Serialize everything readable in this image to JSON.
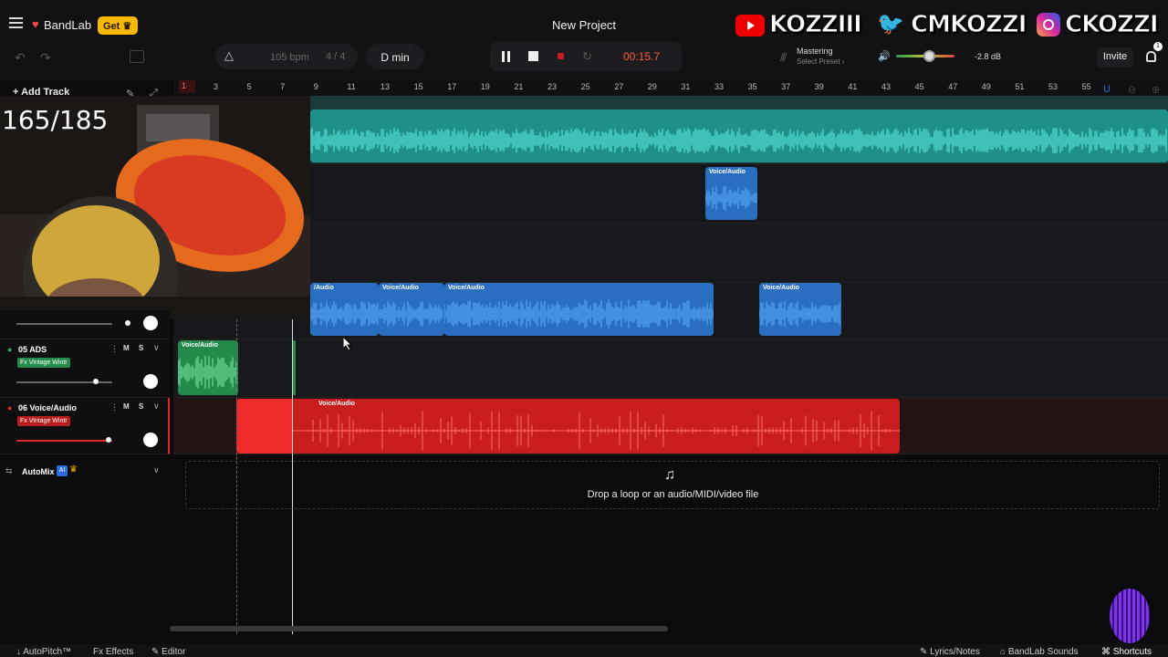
{
  "header": {
    "logo_text": "BandLab",
    "get_label": "Get",
    "project_title": "New Project",
    "socials": {
      "youtube": "KOZZIII",
      "twitter": "CMKOZZI",
      "instagram": "CKOZZI"
    }
  },
  "transport": {
    "bpm": "105 bpm",
    "time_signature": "4 / 4",
    "key": "D min",
    "time": "00:15.7",
    "mastering_label": "Mastering",
    "preset_label": "Select Preset",
    "volume_db": "-2.8 dB",
    "invite_label": "Invite",
    "notification_count": "1"
  },
  "toolbar": {
    "add_track_label": "Add Track"
  },
  "ruler": {
    "playhead_label": "1",
    "bars": [
      "3",
      "5",
      "7",
      "9",
      "11",
      "13",
      "15",
      "17",
      "19",
      "21",
      "23",
      "25",
      "27",
      "29",
      "31",
      "33",
      "35",
      "37",
      "39",
      "41",
      "43",
      "45",
      "47",
      "49",
      "51",
      "53",
      "55"
    ]
  },
  "overlay": {
    "counter": "165/185"
  },
  "tracks": [
    {
      "number": "05",
      "name": "ADS",
      "fx": "Fx Vintage Wintr",
      "mute": "M",
      "solo": "S",
      "color": "#2fae5c",
      "volume": 0.8
    },
    {
      "number": "06",
      "name": "Voice/Audio",
      "fx": "Fx Vintage Wintr",
      "mute": "M",
      "solo": "S",
      "color": "#e02727",
      "volume": 0.95
    }
  ],
  "clips": {
    "label": "Voice/Audio",
    "track2_label": "Voice/Audio",
    "track4": [
      "/Audio",
      "Voice/Audio",
      "Voice/Audio",
      "Voice/Audio"
    ],
    "track5_label": "Voice/Audio",
    "track6_label": "Voice/Audio"
  },
  "automix": {
    "label": "AutoMix",
    "ai_badge": "AI"
  },
  "dropzone": {
    "text": "Drop a loop or an audio/MIDI/video file"
  },
  "bottom_bar": {
    "autopitch": "AutoPitch™",
    "effects": "Effects",
    "editor": "Editor",
    "lyrics": "Lyrics/Notes",
    "sounds": "BandLab Sounds",
    "shortcuts": "Shortcuts"
  },
  "colors": {
    "teal_track": "#26b8b0",
    "blue_clip": "#3a8fe6",
    "green_clip": "#2fae5c",
    "red_clip": "#d42020",
    "accent": "#ff5a3c"
  }
}
